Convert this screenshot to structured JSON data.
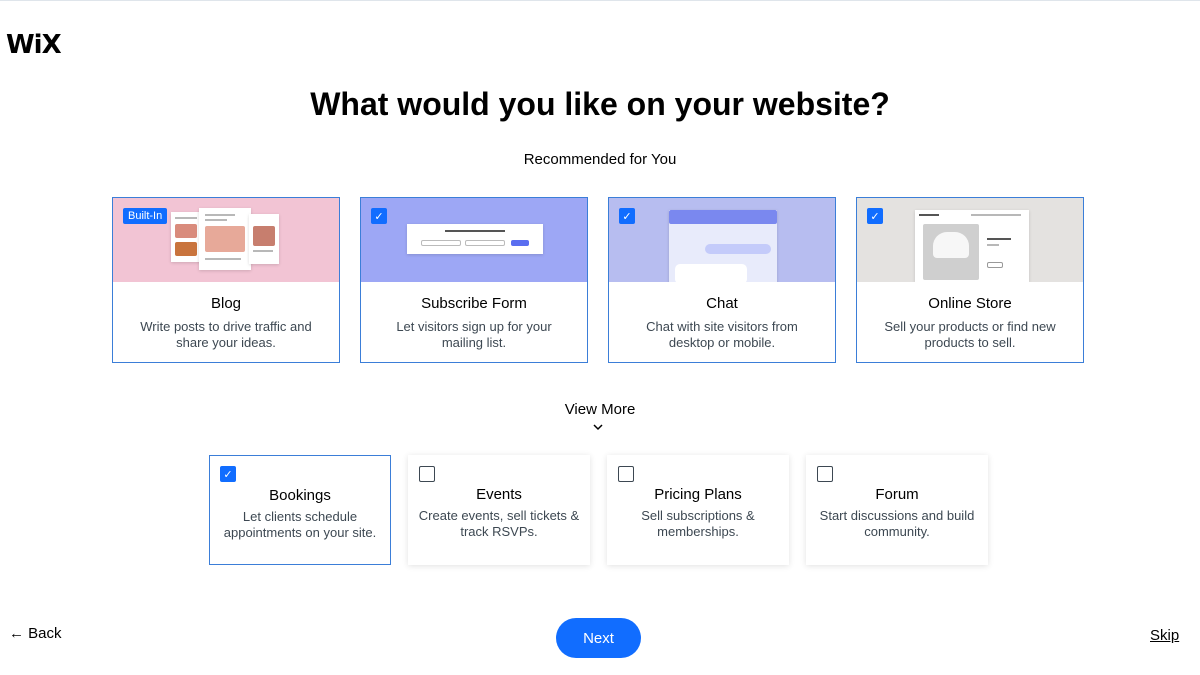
{
  "brand": {
    "logo": "WiX"
  },
  "header": {
    "title": "What would you like on your website?",
    "subtitle": "Recommended for You"
  },
  "recommended": [
    {
      "title": "Blog",
      "description": "Write posts to drive traffic and share your ideas.",
      "badge": "Built-In",
      "checked": true,
      "thumb_color": "#f2c4d4"
    },
    {
      "title": "Subscribe Form",
      "description": "Let visitors sign up for your mailing list.",
      "checked": true,
      "thumb_color": "#9da7f5"
    },
    {
      "title": "Chat",
      "description": "Chat with site visitors from desktop or mobile.",
      "checked": true,
      "thumb_color": "#b7bdf0"
    },
    {
      "title": "Online Store",
      "description": "Sell your products or find new products to sell.",
      "checked": true,
      "thumb_color": "#e4e2e0"
    }
  ],
  "view_more": {
    "label": "View More",
    "icon": "chevron-down-icon"
  },
  "more": [
    {
      "title": "Bookings",
      "description": "Let clients schedule appointments on your site.",
      "checked": true
    },
    {
      "title": "Events",
      "description": "Create events, sell tickets & track RSVPs.",
      "checked": false
    },
    {
      "title": "Pricing Plans",
      "description": "Sell subscriptions & memberships.",
      "checked": false
    },
    {
      "title": "Forum",
      "description": "Start discussions and build community.",
      "checked": false
    }
  ],
  "footer": {
    "back_label": "← Back",
    "next_label": "Next",
    "skip_label": "Skip"
  },
  "colors": {
    "accent": "#116dff",
    "card_border": "#3b7ed8"
  }
}
